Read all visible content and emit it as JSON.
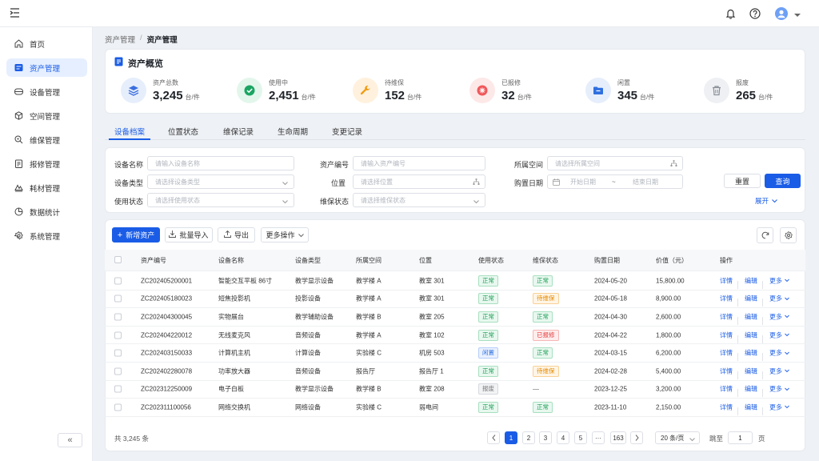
{
  "header": {
    "menu_icon": "menu-fold-icon",
    "bell_icon": "bell-icon",
    "help_icon": "help-icon",
    "avatar_icon": "user-avatar-icon"
  },
  "sidebar": {
    "items": [
      {
        "label": "首页",
        "icon": "home-icon"
      },
      {
        "label": "资产管理",
        "icon": "asset-icon",
        "active": true
      },
      {
        "label": "设备管理",
        "icon": "device-icon"
      },
      {
        "label": "空间管理",
        "icon": "cube-icon"
      },
      {
        "label": "维保管理",
        "icon": "maintenance-icon"
      },
      {
        "label": "报修管理",
        "icon": "repair-icon"
      },
      {
        "label": "耗材管理",
        "icon": "consumable-icon"
      },
      {
        "label": "数据统计",
        "icon": "chart-icon"
      },
      {
        "label": "系统管理",
        "icon": "settings-icon"
      }
    ],
    "collapse_label": "«"
  },
  "breadcrumb": {
    "parent": "资产管理",
    "sep": "/",
    "current": "资产管理"
  },
  "overview": {
    "title": "资产概览",
    "stats": [
      {
        "label": "资产总数",
        "value": "3,245",
        "unit": "台/件",
        "color": "#3b6fe0",
        "bg": "#e6eefc"
      },
      {
        "label": "使用中",
        "value": "2,451",
        "unit": "台/件",
        "color": "#1aa562",
        "bg": "#e3f6ec"
      },
      {
        "label": "待维保",
        "value": "152",
        "unit": "台/件",
        "color": "#f29a12",
        "bg": "#fff1dd"
      },
      {
        "label": "已报修",
        "value": "32",
        "unit": "台/件",
        "color": "#f0575a",
        "bg": "#fde8e8"
      },
      {
        "label": "闲置",
        "value": "345",
        "unit": "台/件",
        "color": "#2f6fe0",
        "bg": "#e6eefc"
      },
      {
        "label": "报废",
        "value": "265",
        "unit": "台/件",
        "color": "#8a8f98",
        "bg": "#eef0f3"
      }
    ]
  },
  "tabs": [
    "设备档案",
    "位置状态",
    "维保记录",
    "生命周期",
    "变更记录"
  ],
  "filters": {
    "name_label": "设备名称",
    "name_ph": "请输入设备名称",
    "code_label": "资产编号",
    "code_ph": "请输入资产编号",
    "space_label": "所属空间",
    "space_ph": "请选择所属空间",
    "type_label": "设备类型",
    "type_ph": "请选择设备类型",
    "loc_label": "位置",
    "loc_ph": "请选择位置",
    "date_label": "购置日期",
    "date_start": "开始日期",
    "date_tilde": "~",
    "date_end": "结束日期",
    "use_label": "使用状态",
    "use_ph": "请选择使用状态",
    "maint_label": "维保状态",
    "maint_ph": "请选择维保状态",
    "reset": "重置",
    "query": "查询",
    "expand": "展开"
  },
  "toolbar": {
    "add": "新增资产",
    "import": "批量导入",
    "export": "导出",
    "more": "更多操作"
  },
  "table": {
    "headers": [
      "资产编号",
      "设备名称",
      "设备类型",
      "所属空间",
      "位置",
      "使用状态",
      "维保状态",
      "购置日期",
      "价值（元）",
      "操作"
    ],
    "actions": {
      "detail": "详情",
      "edit": "编辑",
      "more": "更多"
    },
    "rows": [
      {
        "code": "ZC202405200001",
        "name": "智能交互平板 86寸",
        "type": "教学显示设备",
        "space": "教学楼 A",
        "loc": "教室 301",
        "use": "正常",
        "use_c": "green",
        "maint": "正常",
        "maint_c": "green",
        "date": "2024-05-20",
        "price": "15,800.00"
      },
      {
        "code": "ZC202405180023",
        "name": "短焦投影机",
        "type": "投影设备",
        "space": "教学楼 A",
        "loc": "教室 301",
        "use": "正常",
        "use_c": "green",
        "maint": "待维保",
        "maint_c": "orange",
        "date": "2024-05-18",
        "price": "8,900.00"
      },
      {
        "code": "ZC202404300045",
        "name": "实物展台",
        "type": "教学辅助设备",
        "space": "教学楼 B",
        "loc": "教室 205",
        "use": "正常",
        "use_c": "green",
        "maint": "正常",
        "maint_c": "green",
        "date": "2024-04-30",
        "price": "2,600.00"
      },
      {
        "code": "ZC202404220012",
        "name": "无线麦克风",
        "type": "音频设备",
        "space": "教学楼 A",
        "loc": "教室 102",
        "use": "正常",
        "use_c": "green",
        "maint": "已报修",
        "maint_c": "red",
        "date": "2024-04-22",
        "price": "1,800.00"
      },
      {
        "code": "ZC202403150033",
        "name": "计算机主机",
        "type": "计算设备",
        "space": "实验楼 C",
        "loc": "机房 503",
        "use": "闲置",
        "use_c": "blue",
        "maint": "正常",
        "maint_c": "green",
        "date": "2024-03-15",
        "price": "6,200.00"
      },
      {
        "code": "ZC202402280078",
        "name": "功率放大器",
        "type": "音频设备",
        "space": "报告厅",
        "loc": "报告厅 1",
        "use": "正常",
        "use_c": "green",
        "maint": "待维保",
        "maint_c": "orange",
        "date": "2024-02-28",
        "price": "5,400.00"
      },
      {
        "code": "ZC202312250009",
        "name": "电子白板",
        "type": "教学显示设备",
        "space": "教学楼 B",
        "loc": "教室 208",
        "use": "报废",
        "use_c": "gray",
        "maint": "—",
        "maint_c": "",
        "date": "2023-12-25",
        "price": "3,200.00"
      },
      {
        "code": "ZC202311100056",
        "name": "网络交换机",
        "type": "网络设备",
        "space": "实验楼 C",
        "loc": "弱电间",
        "use": "正常",
        "use_c": "green",
        "maint": "正常",
        "maint_c": "green",
        "date": "2023-11-10",
        "price": "2,150.00"
      }
    ]
  },
  "pagination": {
    "total": "共 3,245 条",
    "pages": [
      "1",
      "2",
      "3",
      "4",
      "5",
      "···",
      "163"
    ],
    "per_page": "20 条/页",
    "goto": "跳至",
    "goto_value": "1",
    "page_suffix": "页"
  }
}
